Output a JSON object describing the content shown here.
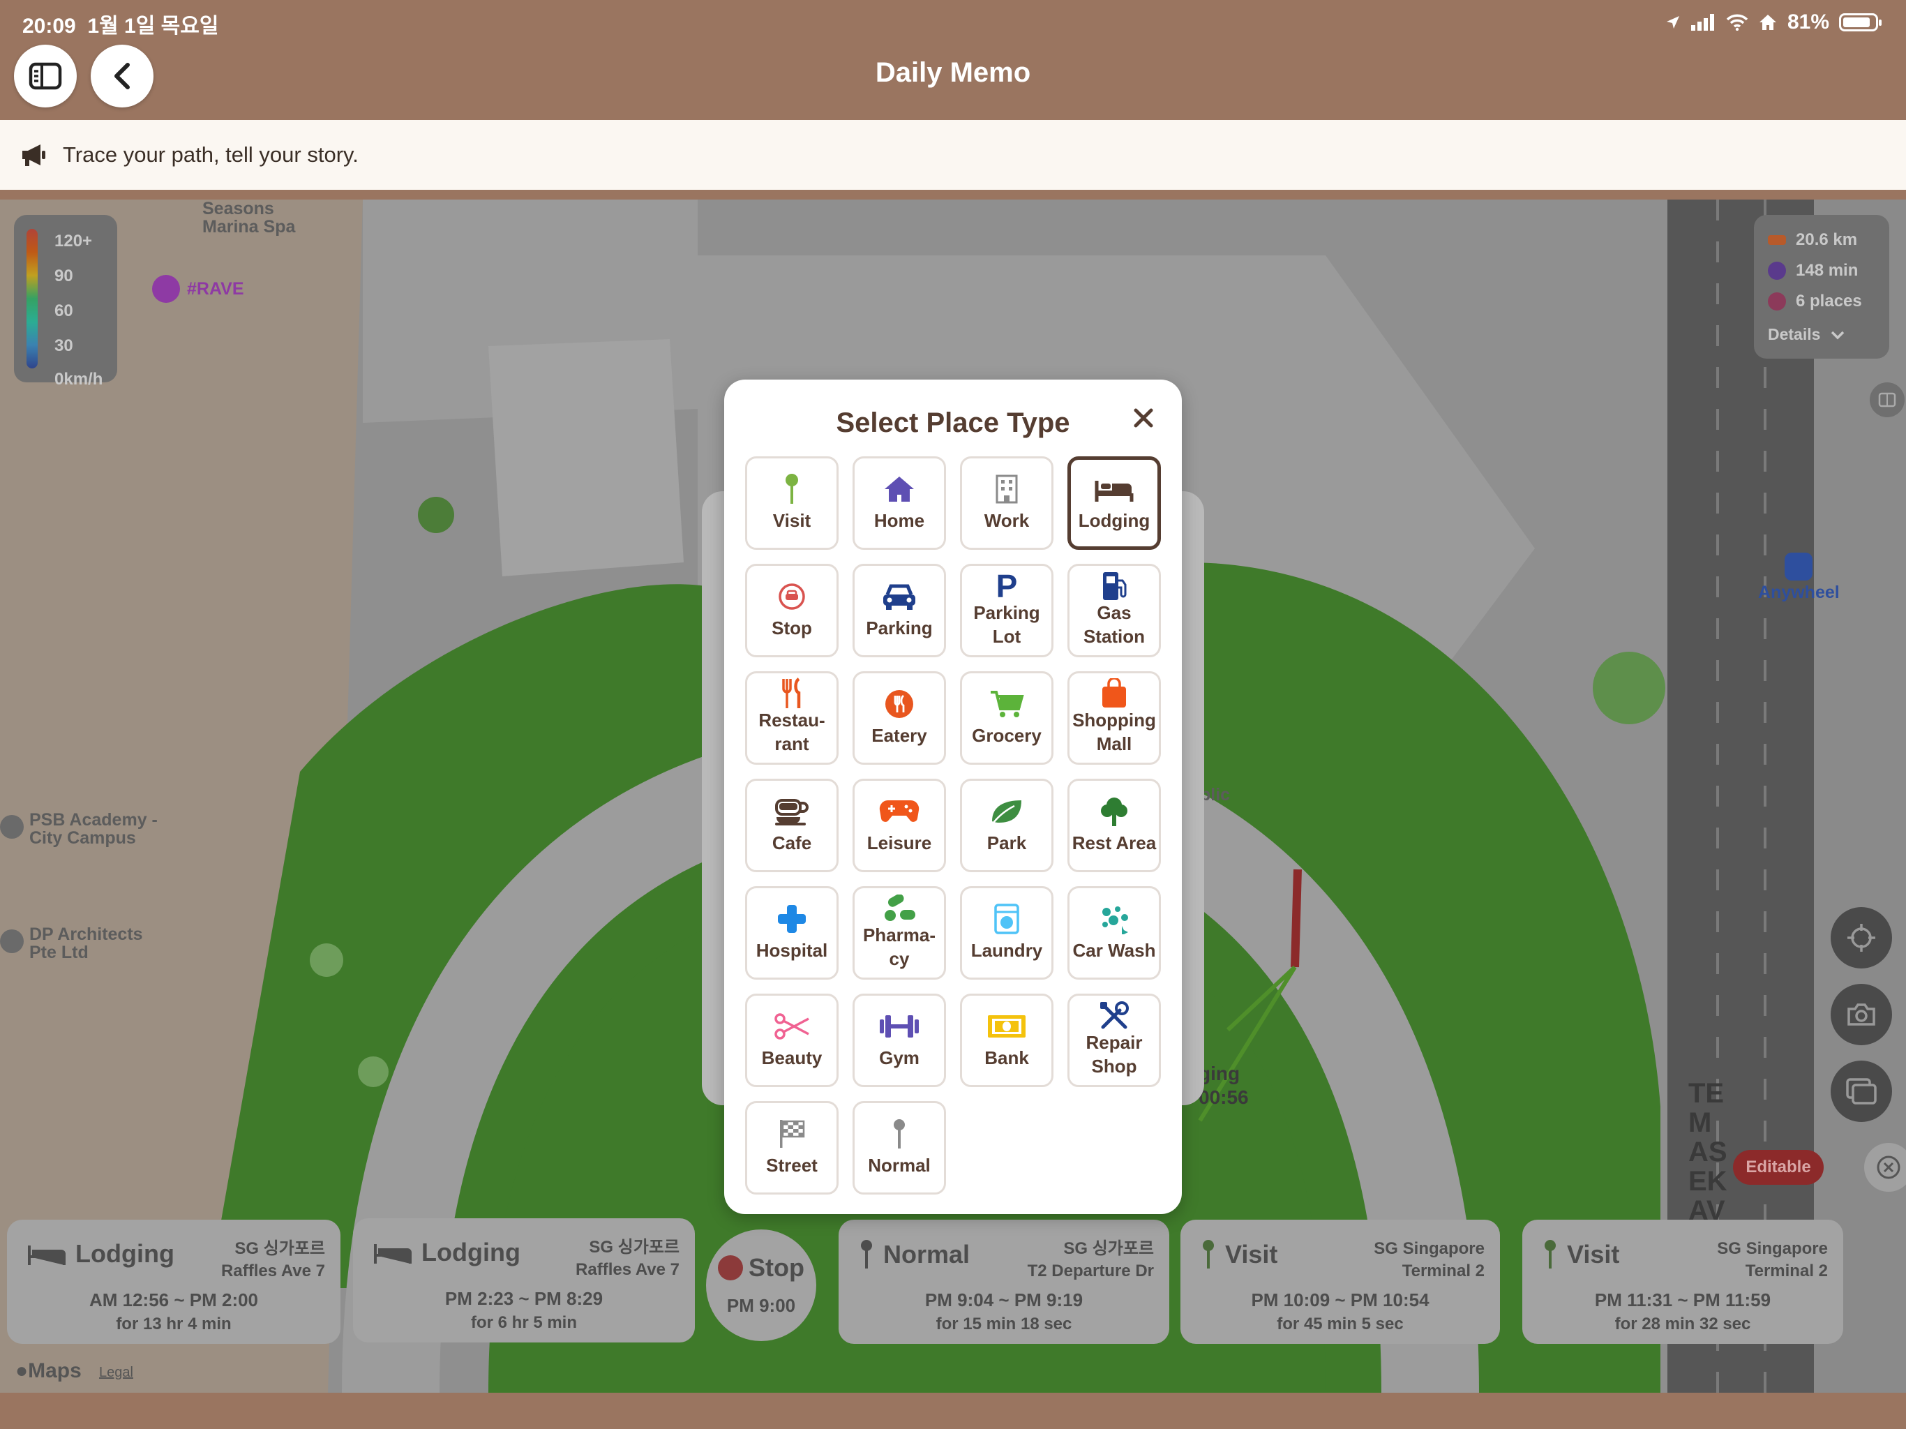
{
  "status_bar": {
    "time": "20:09",
    "date": "1월 1일 목요일",
    "battery": "81%"
  },
  "header": {
    "title": "Daily Memo"
  },
  "banner": {
    "text": "Trace your path, tell your story."
  },
  "map": {
    "labels": {
      "seasons": "Seasons\nMarina Spa",
      "rave": "#RAVE",
      "psb": "PSB Academy -\nCity Campus",
      "dp": "DP Architects\nPte Ltd",
      "anywheel": "Anywheel",
      "temasek": "TEMASEK AV",
      "pic_partial": "blic",
      "lodging_partial": "ging",
      "time_partial": "00:56"
    },
    "speed_legend": [
      "120+",
      "90",
      "60",
      "30",
      "0km/h"
    ],
    "stats": {
      "distance": "20.6 km",
      "duration": "148 min",
      "places": "6 places",
      "details": "Details"
    },
    "editable": "Editable",
    "maps_brand": "Maps",
    "legal": "Legal"
  },
  "timeline": [
    {
      "type": "Lodging",
      "place_line1": "SG 싱가포르",
      "place_line2": "Raffles Ave 7",
      "time": "AM 12:56 ~ PM 2:00",
      "duration": "for 13 hr 4 min"
    },
    {
      "type": "Lodging",
      "place_line1": "SG 싱가포르",
      "place_line2": "Raffles Ave 7",
      "time": "PM 2:23 ~ PM 8:29",
      "duration": "for 6 hr 5 min"
    },
    {
      "type": "Stop",
      "time": "PM 9:00"
    },
    {
      "type": "Normal",
      "place_line1": "SG 싱가포르",
      "place_line2": "T2 Departure Dr",
      "time": "PM 9:04 ~ PM 9:19",
      "duration": "for 15 min 18 sec"
    },
    {
      "type": "Visit",
      "place_line1": "SG Singapore",
      "place_line2": "Terminal 2",
      "time": "PM 10:09 ~ PM 10:54",
      "duration": "for 45 min 5 sec"
    },
    {
      "type": "Visit",
      "place_line1": "SG Singapore",
      "place_line2": "Terminal 2",
      "time": "PM 11:31 ~ PM 11:59",
      "duration": "for 28 min 32 sec"
    }
  ],
  "modal": {
    "title": "Select Place Type",
    "selected": "Lodging",
    "types": [
      {
        "label": "Visit",
        "icon": "pin-icon",
        "color": "#7cb342"
      },
      {
        "label": "Home",
        "icon": "home-icon",
        "color": "#5e4fb3"
      },
      {
        "label": "Work",
        "icon": "building-icon",
        "color": "#8a8a8a"
      },
      {
        "label": "Lodging",
        "icon": "bed-icon",
        "color": "#553d31"
      },
      {
        "label": "Stop",
        "icon": "car-stop-icon",
        "color": "#d9534f"
      },
      {
        "label": "Parking",
        "icon": "car-icon",
        "color": "#1f3f8c"
      },
      {
        "label": "Parking\nLot",
        "icon": "parking-p-icon",
        "color": "#1f3f8c"
      },
      {
        "label": "Gas\nStation",
        "icon": "fuel-icon",
        "color": "#1f3f8c"
      },
      {
        "label": "Restau-\nrant",
        "icon": "utensils-icon",
        "color": "#e8561f"
      },
      {
        "label": "Eatery",
        "icon": "fork-knife-circle-icon",
        "color": "#e8561f"
      },
      {
        "label": "Grocery",
        "icon": "cart-icon",
        "color": "#5cb33a"
      },
      {
        "label": "Shopping\nMall",
        "icon": "shopping-bag-icon",
        "color": "#f0561a"
      },
      {
        "label": "Cafe",
        "icon": "coffee-cup-icon",
        "color": "#553d31"
      },
      {
        "label": "Leisure",
        "icon": "gamepad-icon",
        "color": "#f0561a"
      },
      {
        "label": "Park",
        "icon": "leaf-icon",
        "color": "#3e8e41"
      },
      {
        "label": "Rest Area",
        "icon": "tree-icon",
        "color": "#2e7d32"
      },
      {
        "label": "Hospital",
        "icon": "cross-icon",
        "color": "#1e88e5"
      },
      {
        "label": "Pharma-\ncy",
        "icon": "pills-icon",
        "color": "#43a047"
      },
      {
        "label": "Laundry",
        "icon": "washing-machine-icon",
        "color": "#4fc3f7"
      },
      {
        "label": "Car Wash",
        "icon": "bubbles-icon",
        "color": "#26a69a"
      },
      {
        "label": "Beauty",
        "icon": "scissors-icon",
        "color": "#f06292"
      },
      {
        "label": "Gym",
        "icon": "dumbbell-icon",
        "color": "#5e4fb3"
      },
      {
        "label": "Bank",
        "icon": "banknote-icon",
        "color": "#f4c20d"
      },
      {
        "label": "Repair\nShop",
        "icon": "tools-icon",
        "color": "#1f3f8c"
      },
      {
        "label": "Street",
        "icon": "checkered-flag-icon",
        "color": "#8a8a8a"
      },
      {
        "label": "Normal",
        "icon": "gray-pin-icon",
        "color": "#8a8a8a"
      }
    ]
  }
}
